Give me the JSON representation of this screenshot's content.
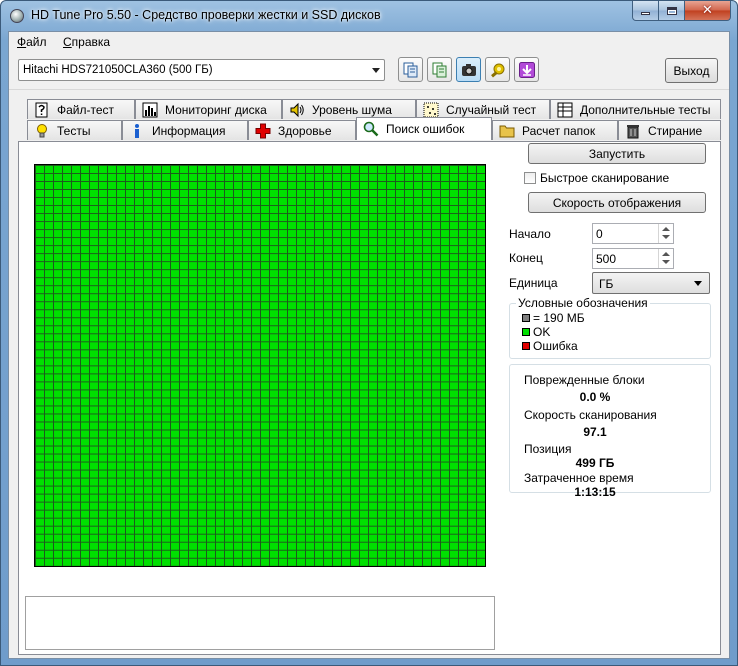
{
  "window": {
    "title": "HD Tune Pro 5.50 - Средство проверки жестки и SSD дисков"
  },
  "menu": {
    "file_first": "Ф",
    "file_rest": "айл",
    "help_first": "С",
    "help_rest": "правка"
  },
  "toolbar": {
    "drive": "Hitachi HDS721050CLA360 (500 ГБ)",
    "exit_label": "Выход"
  },
  "tabs_top": [
    {
      "label": "Файл-тест",
      "icon": "file-test-icon"
    },
    {
      "label": "Мониторинг диска",
      "icon": "monitor-chart-icon"
    },
    {
      "label": "Уровень шума",
      "icon": "speaker-icon"
    },
    {
      "label": "Случайный тест",
      "icon": "random-dots-icon"
    },
    {
      "label": "Дополнительные тесты",
      "icon": "extra-tests-icon"
    }
  ],
  "tabs_bottom": [
    {
      "label": "Тесты",
      "icon": "bulb-icon"
    },
    {
      "label": "Информация",
      "icon": "info-icon"
    },
    {
      "label": "Здоровье",
      "icon": "health-cross-icon"
    },
    {
      "label": "Поиск ошибок",
      "icon": "magnifier-icon",
      "selected": true
    },
    {
      "label": "Расчет папок",
      "icon": "folder-icon"
    },
    {
      "label": "Стирание",
      "icon": "trash-icon"
    }
  ],
  "scan": {
    "start_label": "Запустить",
    "quick_scan_label": "Быстрое сканирование",
    "quick_scan_checked": false,
    "display_speed_label": "Скорость отображения",
    "start_field_label": "Начало",
    "start_value": "0",
    "end_field_label": "Конец",
    "end_value": "500",
    "unit_label": "Единица",
    "unit_value": "ГБ"
  },
  "legend": {
    "title": "Условные обозначения",
    "block_size": "= 190 МБ",
    "ok": "OK",
    "error": "Ошибка",
    "colors": {
      "block": "#808080",
      "ok": "#00e000",
      "error": "#e00000"
    }
  },
  "stats": {
    "damaged_label": "Поврежденные блоки",
    "damaged_value": "0.0 %",
    "speed_label": "Скорость сканирования",
    "speed_value": "97.1",
    "position_label": "Позиция",
    "position_value": "499 ГБ",
    "elapsed_label": "Затраченное время",
    "elapsed_value": "1:13:15"
  },
  "block_map": {
    "status": "all ok",
    "fill_color": "#00e000"
  }
}
